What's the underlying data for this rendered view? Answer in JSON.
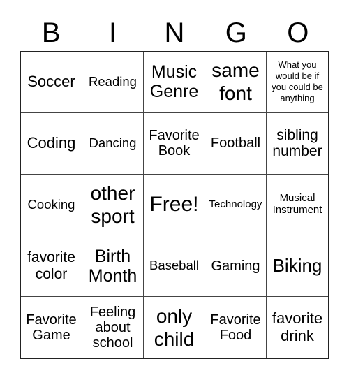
{
  "header": [
    "B",
    "I",
    "N",
    "G",
    "O"
  ],
  "cells": [
    {
      "text": "Soccer",
      "size": "s22"
    },
    {
      "text": "Reading",
      "size": "s18"
    },
    {
      "text": "Music Genre",
      "size": "s25"
    },
    {
      "text": "same font",
      "size": "s28"
    },
    {
      "text": "What you would be if you could be anything",
      "size": "s13"
    },
    {
      "text": "Coding",
      "size": "s22"
    },
    {
      "text": "Dancing",
      "size": "s18"
    },
    {
      "text": "Favorite Book",
      "size": "s20"
    },
    {
      "text": "Football",
      "size": "s20"
    },
    {
      "text": "sibling number",
      "size": "s21"
    },
    {
      "text": "Cooking",
      "size": "s18"
    },
    {
      "text": "other sport",
      "size": "s28"
    },
    {
      "text": "Free!",
      "size": "s30"
    },
    {
      "text": "Technology",
      "size": "s15"
    },
    {
      "text": "Musical Instrument",
      "size": "s15"
    },
    {
      "text": "favorite color",
      "size": "s21"
    },
    {
      "text": "Birth Month",
      "size": "s25"
    },
    {
      "text": "Baseball",
      "size": "s18"
    },
    {
      "text": "Gaming",
      "size": "s20"
    },
    {
      "text": "Biking",
      "size": "s26"
    },
    {
      "text": "Favorite Game",
      "size": "s20"
    },
    {
      "text": "Feeling about school",
      "size": "s20"
    },
    {
      "text": "only child",
      "size": "s28"
    },
    {
      "text": "Favorite Food",
      "size": "s20"
    },
    {
      "text": "favorite drink",
      "size": "s22"
    }
  ]
}
